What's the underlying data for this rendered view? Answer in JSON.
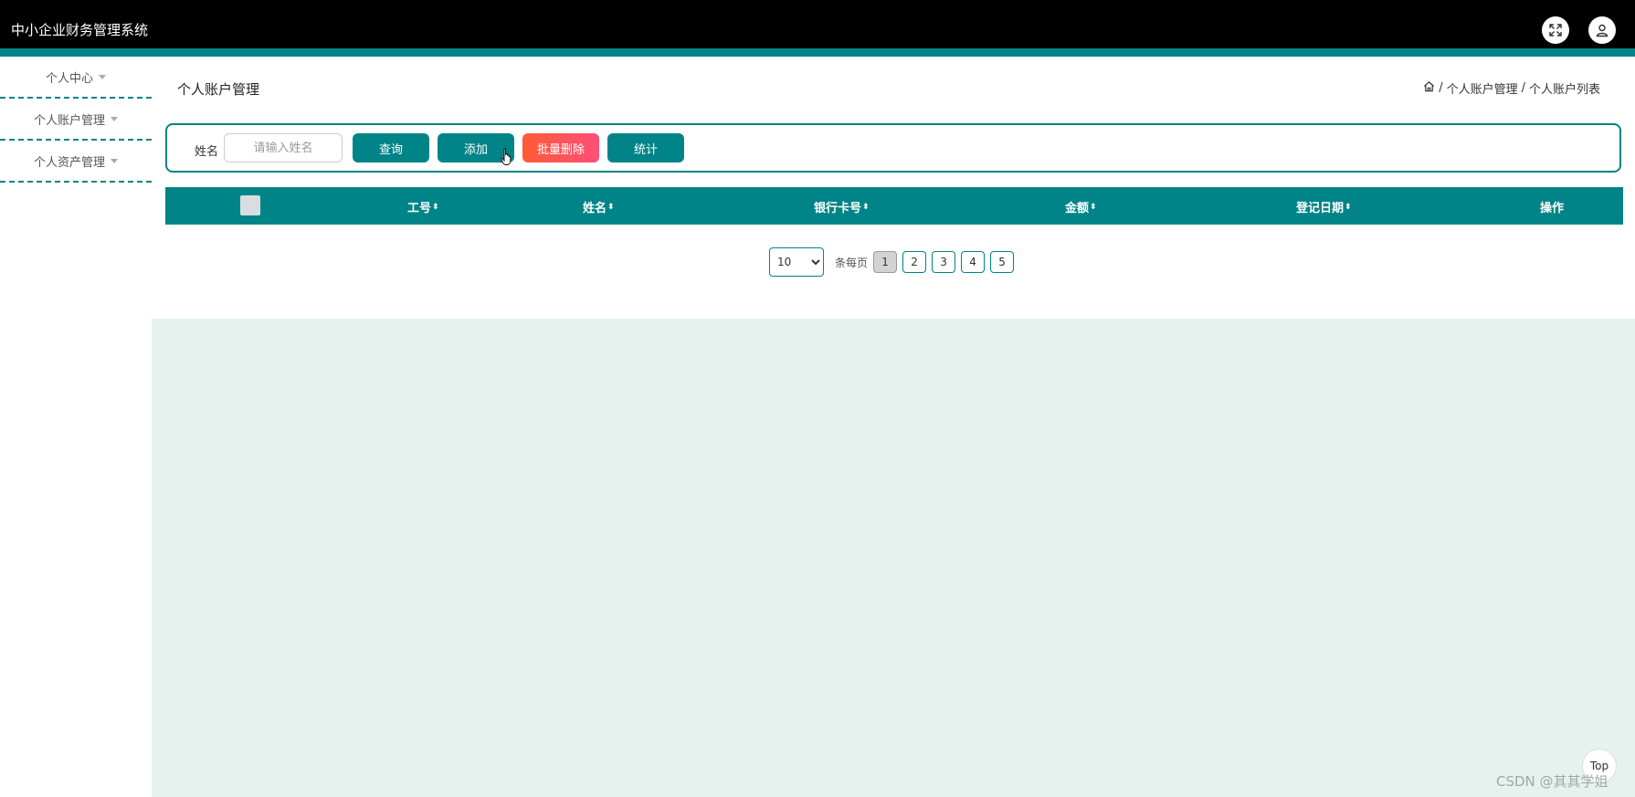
{
  "header": {
    "app_title": "中小企业财务管理系统",
    "fullscreen_icon": "expand-icon",
    "user_icon": "user-icon"
  },
  "sidebar": {
    "items": [
      {
        "label": "个人中心"
      },
      {
        "label": "个人账户管理"
      },
      {
        "label": "个人资产管理"
      }
    ]
  },
  "main": {
    "page_title": "个人账户管理",
    "breadcrumb": {
      "home_icon": "home-icon",
      "separator": "/",
      "level1": "个人账户管理",
      "level2": "个人账户列表"
    },
    "search": {
      "label": "姓名",
      "placeholder": "请输入姓名",
      "value": ""
    },
    "buttons": {
      "query": "查询",
      "add": "添加",
      "batch_delete": "批量删除",
      "stats": "统计"
    },
    "table": {
      "columns": [
        "工号",
        "姓名",
        "银行卡号",
        "金额",
        "登记日期",
        "操作"
      ],
      "sort_glyph": "⬍",
      "rows": []
    },
    "pagination": {
      "page_size": "10",
      "page_size_options": [
        "10"
      ],
      "per_page_label": "条每页",
      "pages": [
        "1",
        "2",
        "3",
        "4",
        "5"
      ],
      "current_page": "1"
    }
  },
  "misc": {
    "top_button": "Top",
    "watermark": "CSDN @其其学姐"
  },
  "colors": {
    "accent": "#008487",
    "topbar": "#000000",
    "danger_gradient_start": "#ff5a36",
    "danger_gradient_end": "#ff4f7a",
    "content_bg": "#e5f2ee"
  }
}
